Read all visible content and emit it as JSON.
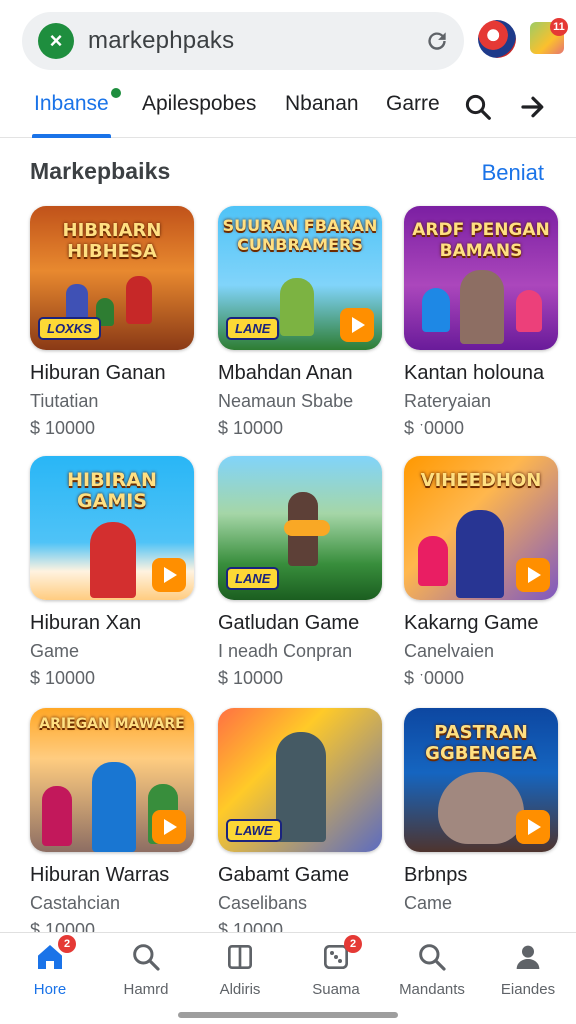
{
  "search": {
    "text": "markephpaks",
    "close_glyph": "×",
    "reload_icon": "reload-icon"
  },
  "extensions": {
    "notification_count": "11"
  },
  "tabs": [
    {
      "label": "Inbanse",
      "active": true
    },
    {
      "label": "Apilespobes",
      "active": false
    },
    {
      "label": "Nbanan",
      "active": false
    },
    {
      "label": "Garre",
      "active": false
    }
  ],
  "section": {
    "title": "Markepbaiks",
    "link": "Beniat"
  },
  "cards": [
    {
      "art_title": "HIBRIARN HIBHESA",
      "tag": "LOXKS",
      "title": "Hiburan Ganan",
      "subtitle": "Tiutatian",
      "price": "$ 10000"
    },
    {
      "art_title": "SUURAN FBARAN CUNBRAMERS",
      "tag": "LANE",
      "title": "Mbahdan Anan",
      "subtitle": "Neamaun Sbabe",
      "price": "$ 10000"
    },
    {
      "art_title": "ARDF PENGAN BAMANS",
      "tag": "",
      "title": "Kantan holouna",
      "subtitle": "Rateryaian",
      "price": "$ ˑ0000"
    },
    {
      "art_title": "HIBIRAN GAMIS",
      "tag": "",
      "title": "Hiburan Xan",
      "subtitle": "Game",
      "price": "$ 10000"
    },
    {
      "art_title": "",
      "tag": "LANE",
      "title": "Gatludan Game",
      "subtitle": "I neadh Conpran",
      "price": "$ 10000"
    },
    {
      "art_title": "VIHEEDHON",
      "tag": "",
      "title": "Kakarng Game",
      "subtitle": "Canelvaien",
      "price": "$ ˑ0000"
    },
    {
      "art_title": "ARIEGAN MAWARE",
      "tag": "",
      "title": "Hiburan Warras",
      "subtitle": "Castahcian",
      "price": "$ 10000"
    },
    {
      "art_title": "",
      "tag": "LAWE",
      "title": "Gabamt Game",
      "subtitle": "Caselibans",
      "price": "$ 10000"
    },
    {
      "art_title": "PASTRAN GGBENGEA",
      "tag": "",
      "title": "Brbnps",
      "subtitle": "Came",
      "price": ""
    }
  ],
  "colors": {
    "accent": "#1a73e8",
    "green": "#1e8e3e",
    "badge": "#e53935"
  },
  "bottom_nav": [
    {
      "label": "Hore",
      "icon": "home-icon",
      "badge": "2",
      "active": true
    },
    {
      "label": "Hamrd",
      "icon": "search-icon",
      "badge": "",
      "active": false
    },
    {
      "label": "Aldiris",
      "icon": "library-icon",
      "badge": "",
      "active": false
    },
    {
      "label": "Suama",
      "icon": "dice-icon",
      "badge": "2",
      "active": false
    },
    {
      "label": "Mandants",
      "icon": "search-icon",
      "badge": "",
      "active": false
    },
    {
      "label": "Eiandes",
      "icon": "person-icon",
      "badge": "",
      "active": false
    }
  ]
}
